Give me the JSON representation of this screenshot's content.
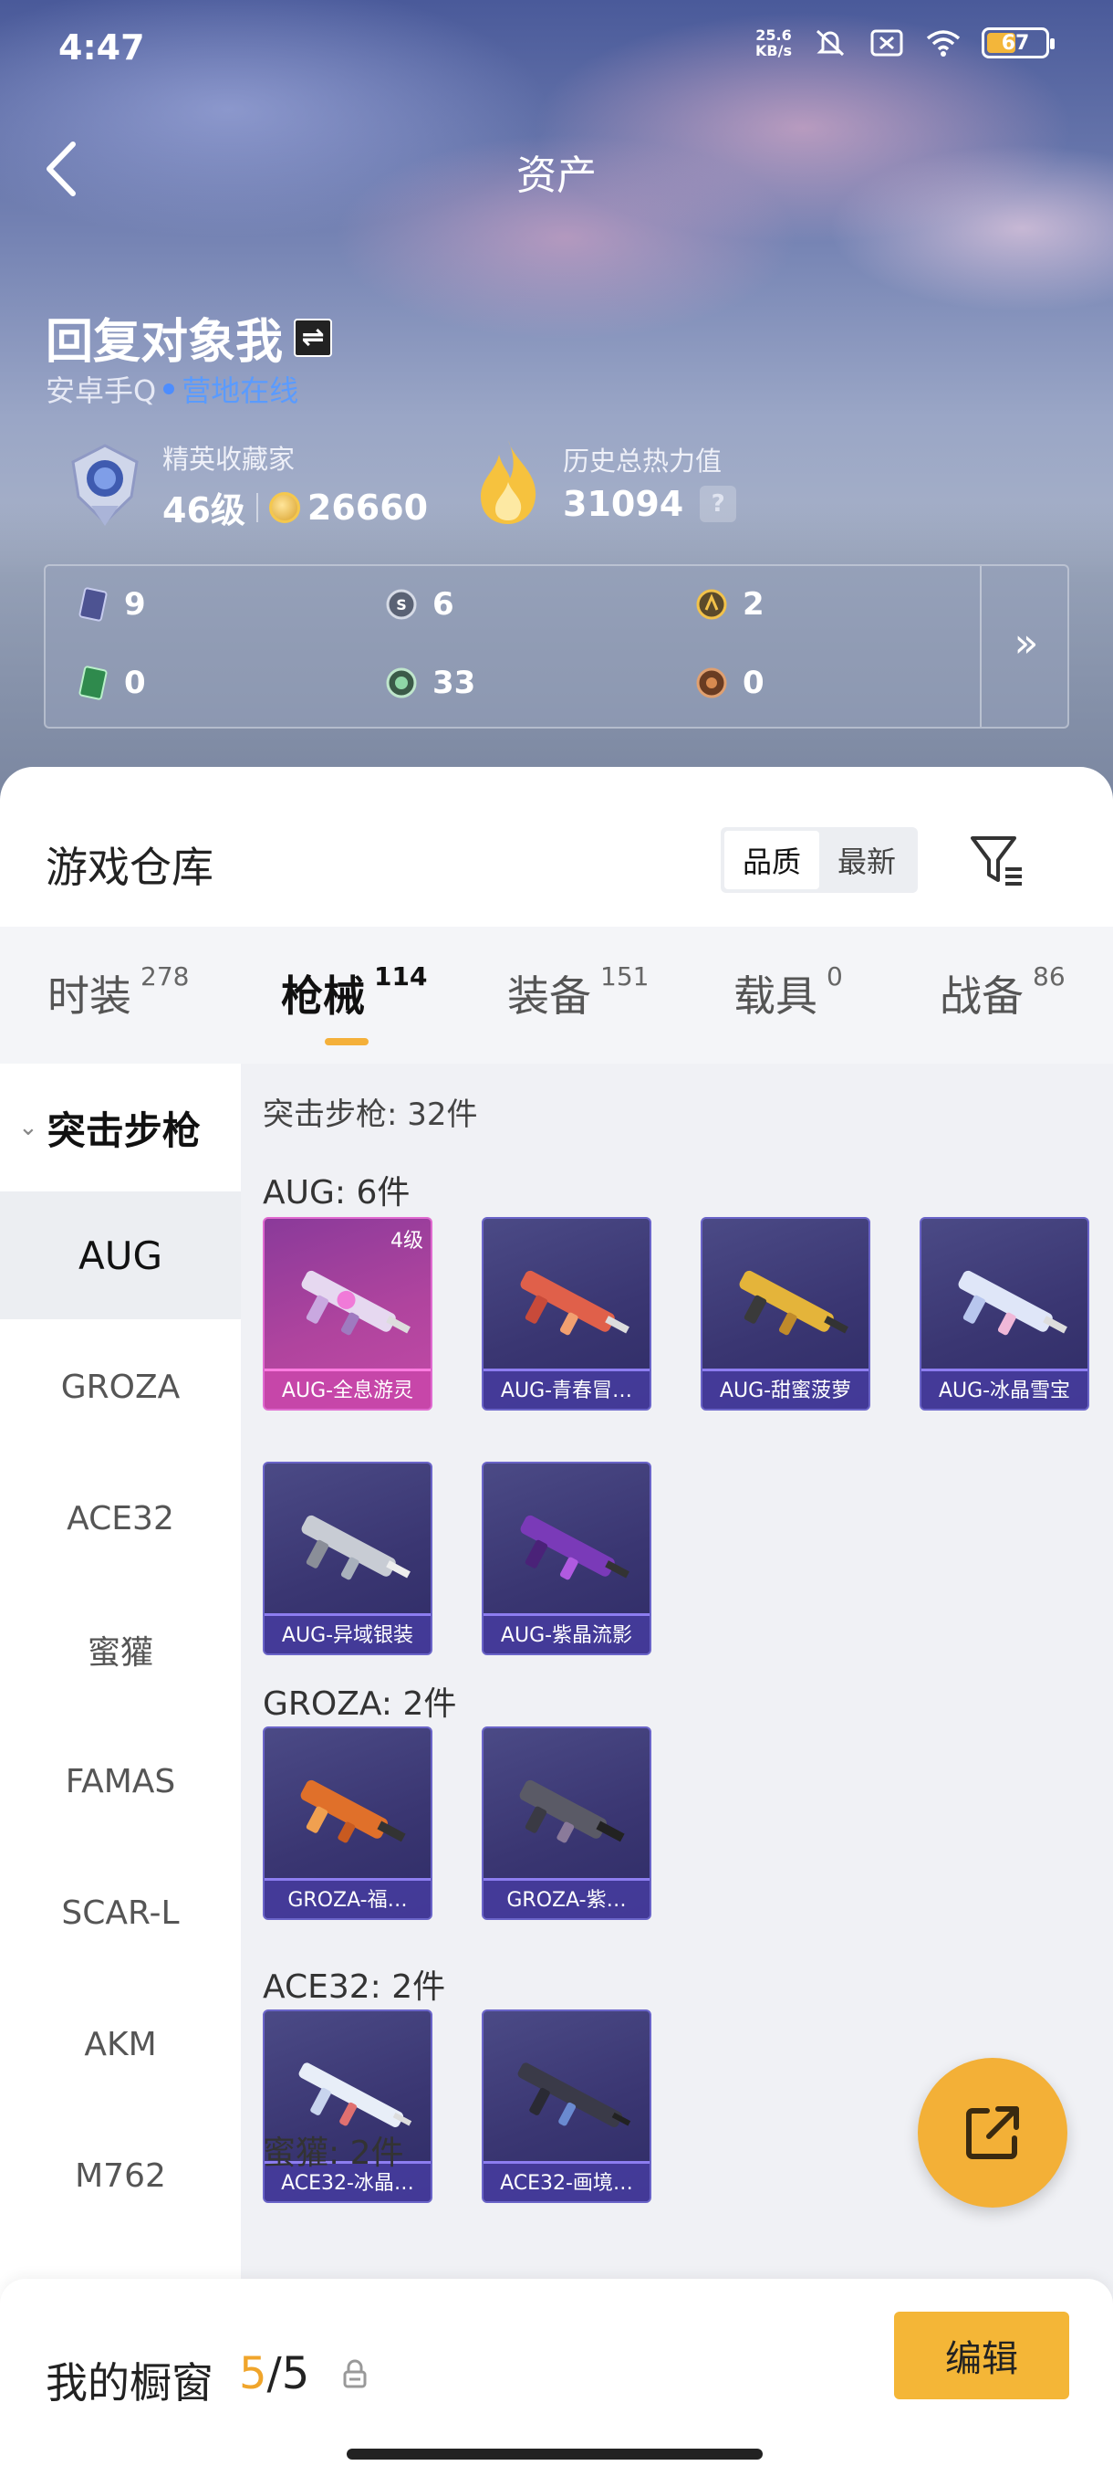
{
  "status_bar": {
    "time": "4:47",
    "net_speed_value": "25.6",
    "net_speed_unit": "KB/s",
    "battery": "67"
  },
  "nav": {
    "title": "资产"
  },
  "profile": {
    "name": "回复对象我",
    "platform": "安卓手Q",
    "online_status": "营地在线",
    "collector_title": "精英收藏家",
    "level": "46级",
    "coins": "26660",
    "heat_label": "历史总热力值",
    "heat_value": "31094"
  },
  "resources": [
    {
      "icon": "card-icon",
      "value": "9"
    },
    {
      "icon": "silver-coin-icon",
      "value": "6"
    },
    {
      "icon": "gold-coin-icon",
      "value": "2"
    },
    {
      "icon": "green-card-icon",
      "value": "0"
    },
    {
      "icon": "green-orb-icon",
      "value": "33"
    },
    {
      "icon": "bronze-coin-icon",
      "value": "0"
    }
  ],
  "warehouse": {
    "title": "游戏仓库",
    "sort_options": [
      "品质",
      "最新"
    ],
    "active_sort": "品质"
  },
  "tabs": [
    {
      "label": "时装",
      "count": "278"
    },
    {
      "label": "枪械",
      "count": "114",
      "active": true
    },
    {
      "label": "装备",
      "count": "151"
    },
    {
      "label": "载具",
      "count": "0"
    },
    {
      "label": "战备",
      "count": "86"
    }
  ],
  "sidebar": {
    "category": "突击步枪",
    "items": [
      "AUG",
      "GROZA",
      "ACE32",
      "蜜獾",
      "FAMAS",
      "SCAR-L",
      "AKM",
      "M762"
    ],
    "active": "AUG"
  },
  "content": {
    "category_title": "突击步枪: 32件",
    "groups": [
      {
        "title": "AUG: 6件",
        "items": [
          {
            "name": "AUG-全息游灵",
            "level": "4级",
            "special": true
          },
          {
            "name": "AUG-青春冒…"
          },
          {
            "name": "AUG-甜蜜菠萝"
          },
          {
            "name": "AUG-冰晶雪宝"
          },
          {
            "name": "AUG-异域银装"
          },
          {
            "name": "AUG-紫晶流影"
          }
        ]
      },
      {
        "title": "GROZA: 2件",
        "items": [
          {
            "name": "GROZA-福…"
          },
          {
            "name": "GROZA-紫…"
          }
        ]
      },
      {
        "title": "ACE32: 2件",
        "items": [
          {
            "name": "ACE32-冰晶…"
          },
          {
            "name": "ACE32-画境…"
          }
        ]
      },
      {
        "title": "蜜獾: 2件",
        "items": []
      }
    ]
  },
  "showcase": {
    "label": "我的橱窗",
    "current": "5",
    "total": "/5",
    "edit_label": "编辑"
  },
  "colors": {
    "accent": "#f4b637",
    "online_blue": "#4d8dff",
    "card_purple": "#3a3672",
    "card_pink": "#b0449e"
  }
}
